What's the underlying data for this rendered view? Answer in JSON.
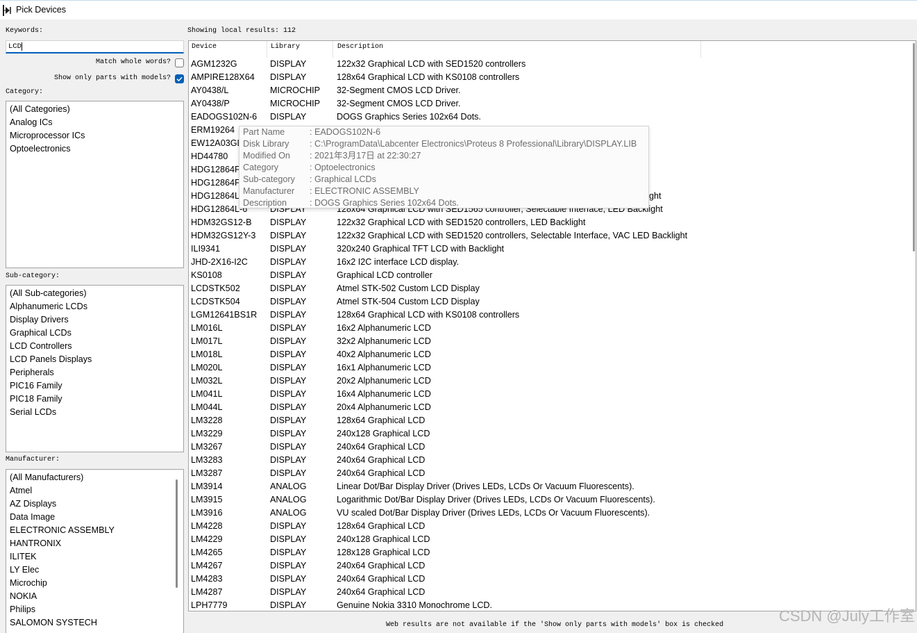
{
  "window": {
    "title": "Pick Devices",
    "icon": "pick-devices-icon"
  },
  "colors": {
    "accent": "#005fb8",
    "dialog_background": "#f0f0f0",
    "tooltip_text": "#6d6d6d",
    "watermark": "#b4b4b4"
  },
  "left": {
    "keywords": {
      "label": "Keywords:",
      "value": "LCD"
    },
    "match_whole_words": {
      "label": "Match whole words?",
      "checked": false
    },
    "models_only": {
      "label": "Show only parts with models?",
      "checked": true
    },
    "category": {
      "label": "Category:",
      "items": [
        "(All Categories)",
        "Analog ICs",
        "Microprocessor ICs",
        "Optoelectronics"
      ]
    },
    "subcategory": {
      "label": "Sub-category:",
      "items": [
        "(All Sub-categories)",
        "Alphanumeric LCDs",
        "Display Drivers",
        "Graphical LCDs",
        "LCD Controllers",
        "LCD Panels Displays",
        "Peripherals",
        "PIC16 Family",
        "PIC18 Family",
        "Serial LCDs"
      ]
    },
    "manufacturer": {
      "label": "Manufacturer:",
      "items": [
        "(All Manufacturers)",
        "Atmel",
        "AZ Displays",
        "Data Image",
        "ELECTRONIC ASSEMBLY",
        "HANTRONIX",
        "ILITEK",
        "LY Elec",
        "Microchip",
        "NOKIA",
        "Philips",
        "SALOMON SYSTECH"
      ]
    }
  },
  "results": {
    "summary": "Showing local results: 112",
    "columns": {
      "device": "Device",
      "library": "Library",
      "description": "Description"
    },
    "rows": [
      {
        "device": "AGM1232G",
        "library": "DISPLAY",
        "description": "122x32 Graphical LCD with SED1520 controllers"
      },
      {
        "device": "AMPIRE128X64",
        "library": "DISPLAY",
        "description": "128x64 Graphical LCD with KS0108 controllers"
      },
      {
        "device": "AY0438/L",
        "library": "MICROCHIP",
        "description": "32-Segment CMOS LCD Driver."
      },
      {
        "device": "AY0438/P",
        "library": "MICROCHIP",
        "description": "32-Segment CMOS LCD Driver."
      },
      {
        "device": "EADOGS102N-6",
        "library": "DISPLAY",
        "description": "DOGS Graphics Series 102x64 Dots."
      },
      {
        "device": "ERM19264",
        "library": "",
        "description": ""
      },
      {
        "device": "EW12A03GL",
        "library": "",
        "description": ""
      },
      {
        "device": "HD44780",
        "library": "",
        "description": ""
      },
      {
        "device": "HDG12864F",
        "library": "",
        "description": ""
      },
      {
        "device": "HDG12864F",
        "library": "",
        "description": ""
      },
      {
        "device": "HDG12864L",
        "library": "",
        "description": "ght"
      },
      {
        "device": "HDG12864L-6",
        "library": "DISPLAY",
        "description": "128x64 Graphical LCD with SED1565 controller, Selectable Interface, LED Backlight"
      },
      {
        "device": "HDM32GS12-B",
        "library": "DISPLAY",
        "description": "122x32 Graphical LCD with SED1520 controllers, LED Backlight"
      },
      {
        "device": "HDM32GS12Y-3",
        "library": "DISPLAY",
        "description": "122x32 Graphical LCD with SED1520 controllers, Selectable Interface, VAC LED Backlight"
      },
      {
        "device": "ILI9341",
        "library": "DISPLAY",
        "description": "320x240 Graphical TFT LCD with Backlight"
      },
      {
        "device": "JHD-2X16-I2C",
        "library": "DISPLAY",
        "description": "16x2 I2C interface LCD display."
      },
      {
        "device": "KS0108",
        "library": "DISPLAY",
        "description": "Graphical LCD controller"
      },
      {
        "device": "LCDSTK502",
        "library": "DISPLAY",
        "description": "Atmel STK-502 Custom LCD Display"
      },
      {
        "device": "LCDSTK504",
        "library": "DISPLAY",
        "description": "Atmel STK-504 Custom LCD Display"
      },
      {
        "device": "LGM12641BS1R",
        "library": "DISPLAY",
        "description": "128x64 Graphical LCD with KS0108 controllers"
      },
      {
        "device": "LM016L",
        "library": "DISPLAY",
        "description": "16x2 Alphanumeric LCD"
      },
      {
        "device": "LM017L",
        "library": "DISPLAY",
        "description": "32x2 Alphanumeric LCD"
      },
      {
        "device": "LM018L",
        "library": "DISPLAY",
        "description": "40x2 Alphanumeric LCD"
      },
      {
        "device": "LM020L",
        "library": "DISPLAY",
        "description": "16x1 Alphanumeric LCD"
      },
      {
        "device": "LM032L",
        "library": "DISPLAY",
        "description": "20x2 Alphanumeric LCD"
      },
      {
        "device": "LM041L",
        "library": "DISPLAY",
        "description": "16x4 Alphanumeric LCD"
      },
      {
        "device": "LM044L",
        "library": "DISPLAY",
        "description": "20x4 Alphanumeric LCD"
      },
      {
        "device": "LM3228",
        "library": "DISPLAY",
        "description": "128x64 Graphical LCD"
      },
      {
        "device": "LM3229",
        "library": "DISPLAY",
        "description": "240x128 Graphical LCD"
      },
      {
        "device": "LM3267",
        "library": "DISPLAY",
        "description": "240x64 Graphical LCD"
      },
      {
        "device": "LM3283",
        "library": "DISPLAY",
        "description": "240x64 Graphical LCD"
      },
      {
        "device": "LM3287",
        "library": "DISPLAY",
        "description": "240x64 Graphical LCD"
      },
      {
        "device": "LM3914",
        "library": "ANALOG",
        "description": "Linear Dot/Bar Display Driver (Drives LEDs, LCDs Or Vacuum Fluorescents)."
      },
      {
        "device": "LM3915",
        "library": "ANALOG",
        "description": "Logarithmic Dot/Bar Display Driver (Drives LEDs, LCDs Or Vacuum Fluorescents)."
      },
      {
        "device": "LM3916",
        "library": "ANALOG",
        "description": "VU scaled Dot/Bar Display Driver (Drives LEDs, LCDs Or Vacuum Fluorescents)."
      },
      {
        "device": "LM4228",
        "library": "DISPLAY",
        "description": "128x64 Graphical LCD"
      },
      {
        "device": "LM4229",
        "library": "DISPLAY",
        "description": "240x128 Graphical LCD"
      },
      {
        "device": "LM4265",
        "library": "DISPLAY",
        "description": "128x128 Graphical LCD"
      },
      {
        "device": "LM4267",
        "library": "DISPLAY",
        "description": "240x64 Graphical LCD"
      },
      {
        "device": "LM4283",
        "library": "DISPLAY",
        "description": "240x64 Graphical LCD"
      },
      {
        "device": "LM4287",
        "library": "DISPLAY",
        "description": "240x64 Graphical LCD"
      },
      {
        "device": "LPH7779",
        "library": "DISPLAY",
        "description": "Genuine Nokia 3310 Monochrome LCD."
      }
    ]
  },
  "tooltip": {
    "separator": ":",
    "rows": [
      {
        "label": "Part Name",
        "value": "EADOGS102N-6"
      },
      {
        "label": "Disk Library",
        "value": "C:\\ProgramData\\Labcenter Electronics\\Proteus 8 Professional\\Library\\DISPLAY.LIB"
      },
      {
        "label": "Modified On",
        "value": "2021年3月17日 at 22:30:27"
      },
      {
        "label": "Category",
        "value": "Optoelectronics"
      },
      {
        "label": "Sub-category",
        "value": "Graphical LCDs"
      },
      {
        "label": "Manufacturer",
        "value": "ELECTRONIC ASSEMBLY"
      },
      {
        "label": "Description",
        "value": "DOGS Graphics Series 102x64 Dots."
      }
    ]
  },
  "footer": {
    "note": "Web results are not available if the 'Show only parts with models' box is checked"
  },
  "watermark": "CSDN @July工作室"
}
